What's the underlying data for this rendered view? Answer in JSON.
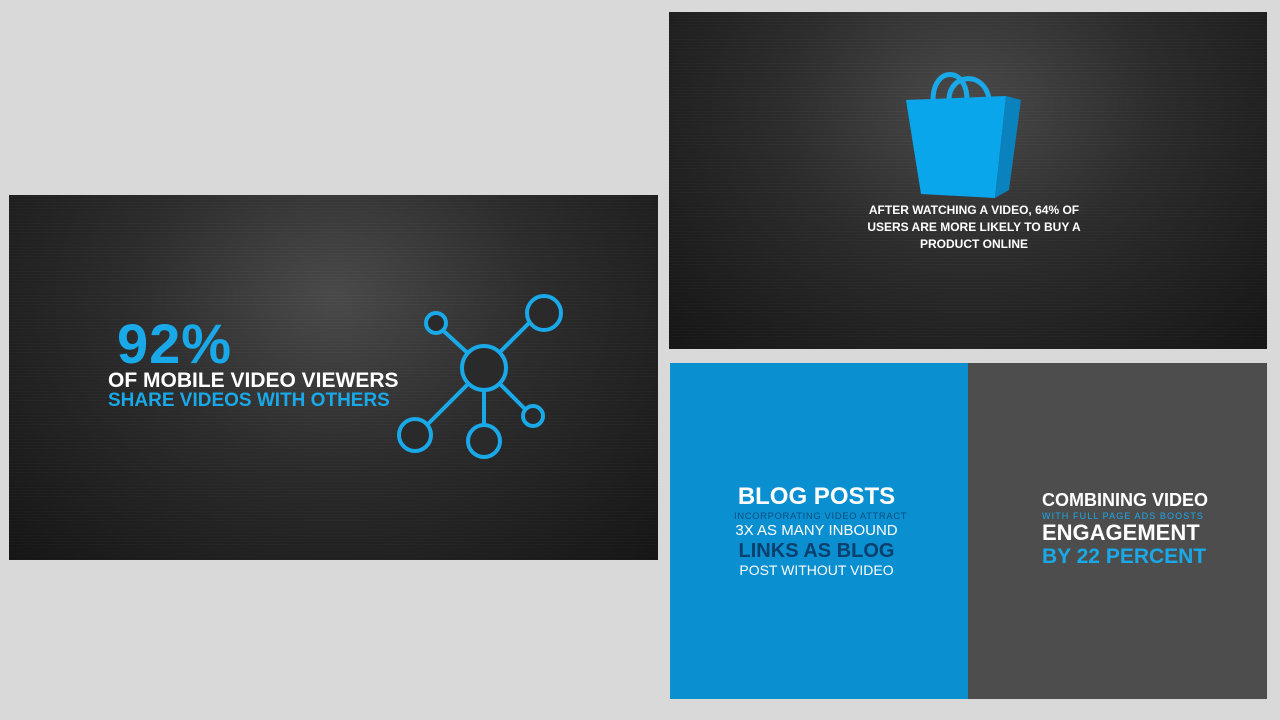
{
  "slide_mobile_share": {
    "stat": "92%",
    "line1": "OF MOBILE VIDEO VIEWERS",
    "line2": "SHARE VIDEOS WITH OTHERS",
    "icon": "network-share-icon"
  },
  "slide_purchase": {
    "icon": "shopping-bag-icon",
    "caption_lines": [
      "AFTER WATCHING A VIDEO, 64% OF",
      "USERS ARE MORE LIKELY TO BUY A",
      "PRODUCT ONLINE"
    ]
  },
  "slide_blog": {
    "title": "BLOG POSTS",
    "line1": "INCORPORATING VIDEO ATTRACT",
    "line2": "3X AS MANY INBOUND",
    "line3": "LINKS AS BLOG",
    "line4": "POST  WITHOUT VIDEO"
  },
  "slide_engagement": {
    "title": "COMBINING VIDEO",
    "line1": "WITH  FULL  PAGE  ADS  BOOSTS",
    "line2": "ENGAGEMENT",
    "line3": "BY 22 PERCENT"
  },
  "colors": {
    "accent_blue": "#1aa9e8",
    "blog_panel": "#0a8fd0",
    "engagement_panel": "#4d4d4d",
    "dark_panel": "#2c2c2c",
    "background": "#d9d9d9"
  }
}
